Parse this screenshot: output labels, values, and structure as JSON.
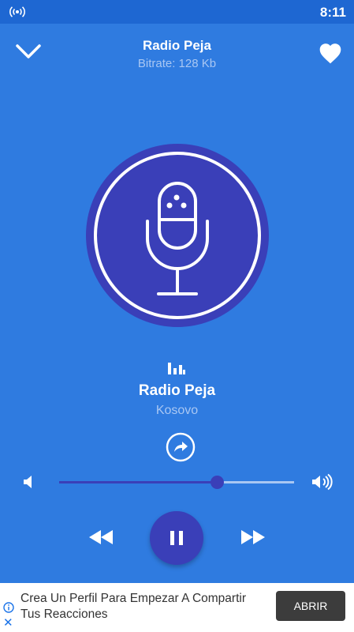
{
  "status_bar": {
    "time": "8:11",
    "left_icon": "radio-signal-icon"
  },
  "header": {
    "title": "Radio Peja",
    "subtitle": "Bitrate: 128 Kb",
    "left_icon": "chevron-down-icon",
    "right_icon": "heart-icon"
  },
  "station": {
    "artwork_icon": "microphone-icon",
    "name": "Radio Peja",
    "country": "Kosovo"
  },
  "player": {
    "volume": 0.67,
    "controls": [
      "rewind-icon",
      "pause-icon",
      "fast-forward-icon"
    ]
  },
  "ad": {
    "text": "Crea Un Perfil Para Empezar A Compartir Tus Reacciones",
    "button_label": "ABRIR"
  },
  "colors": {
    "background": "#2f7be0",
    "status_bar": "#1e67d2",
    "accent": "#3a3fb8",
    "muted_text": "#a9c7f3"
  }
}
